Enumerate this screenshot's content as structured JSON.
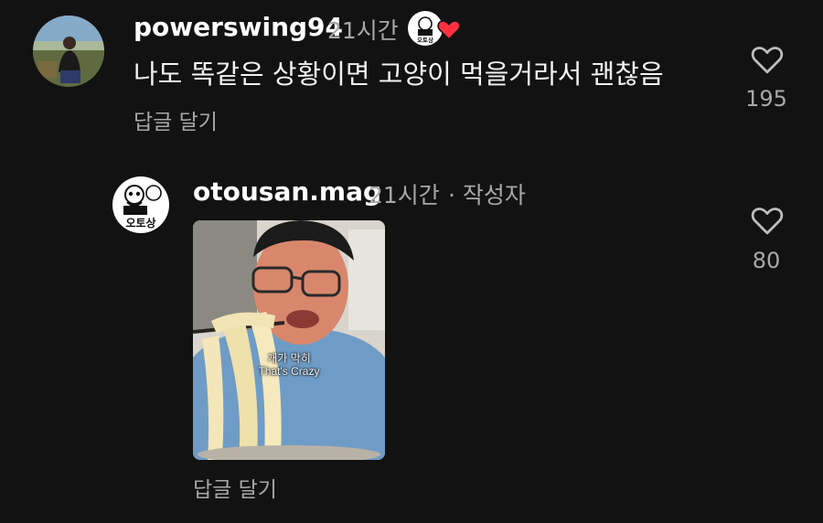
{
  "comment": {
    "username": "powerswing94",
    "time": "21시간",
    "text": "나도 똑같은 상황이면 고양이 먹을거라서 괜찮음",
    "reply_label": "답글 달기",
    "like_count": "195"
  },
  "reply": {
    "username": "otousan.mag",
    "time": "21시간",
    "author_tag": "· 작성자",
    "reply_label": "답글 달기",
    "like_count": "80",
    "media": {
      "subtitle_ko": "개가 막히",
      "subtitle_en": "That's Crazy"
    }
  },
  "brand": {
    "logo_text": "오토상"
  },
  "colors": {
    "background": "#121212",
    "primary_text": "#ffffff",
    "secondary_text": "#a8a8a8",
    "heart_red": "#ff3040"
  },
  "icons": [
    "heart-outline-icon",
    "heart-filled-icon"
  ]
}
